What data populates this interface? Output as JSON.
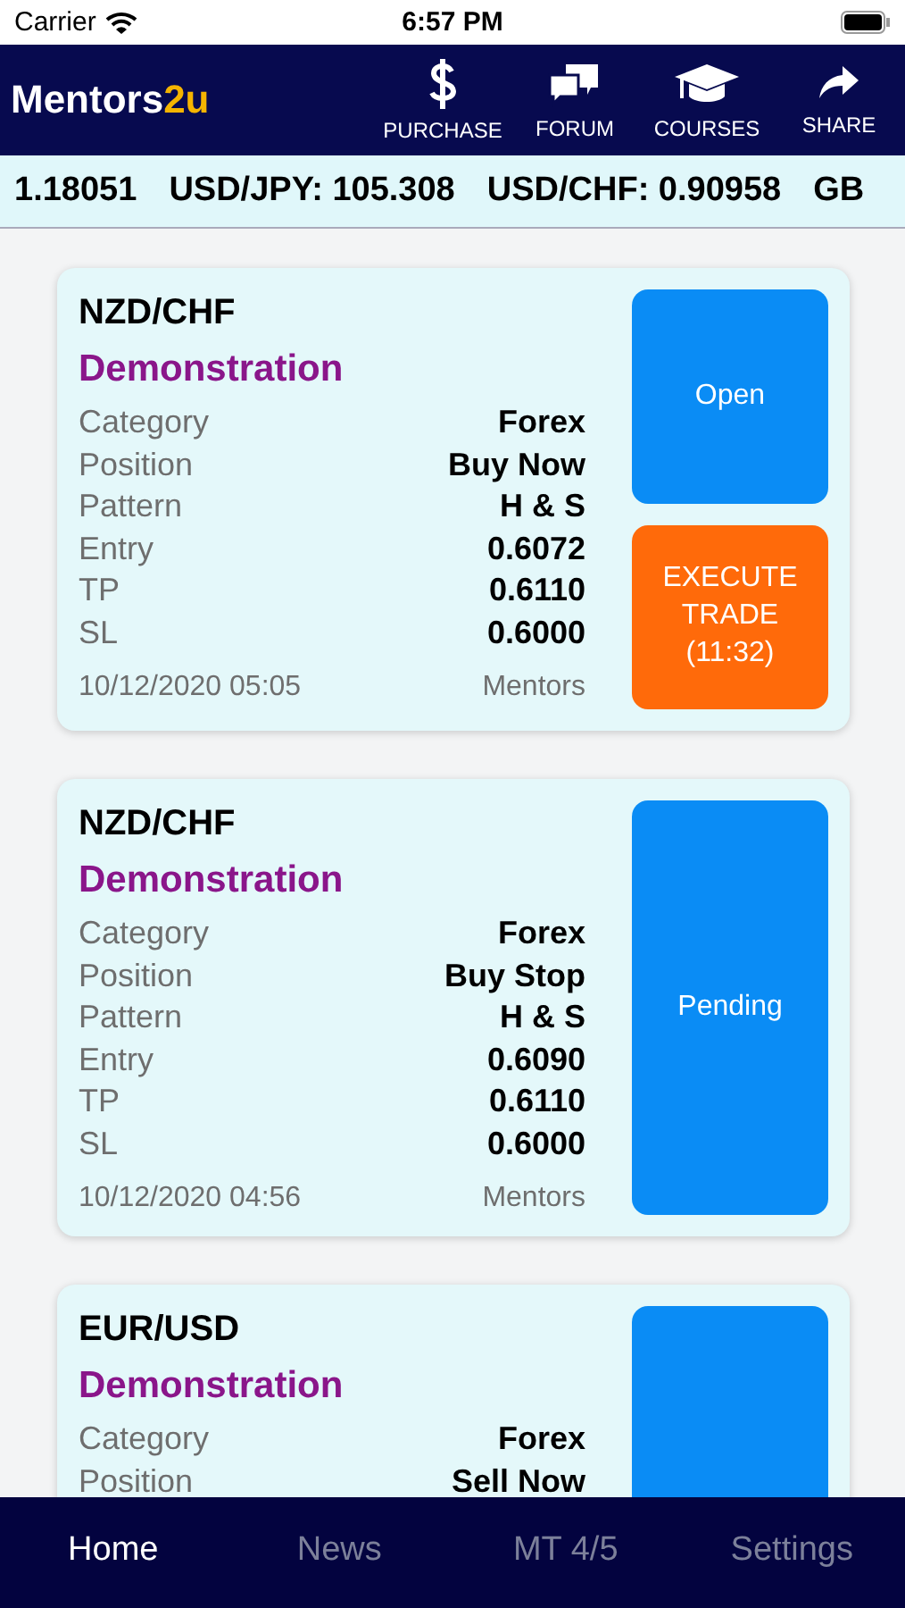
{
  "status_bar": {
    "carrier": "Carrier",
    "time": "6:57 PM"
  },
  "header": {
    "logo_main": "Mentors",
    "logo_accent": "2u",
    "actions": [
      {
        "label": "PURCHASE",
        "kind": "dollar"
      },
      {
        "label": "FORUM",
        "kind": "chat"
      },
      {
        "label": "COURSES",
        "kind": "cap"
      },
      {
        "label": "SHARE",
        "kind": "share"
      }
    ]
  },
  "ticker": [
    "1.18051",
    "USD/JPY: 105.308",
    "USD/CHF: 0.90958",
    "GB"
  ],
  "signals": [
    {
      "pair": "NZD/CHF",
      "type": "Demonstration",
      "rows": [
        {
          "label": "Category",
          "value": "Forex"
        },
        {
          "label": "Position",
          "value": "Buy Now"
        },
        {
          "label": "Pattern",
          "value": "H & S"
        },
        {
          "label": "Entry",
          "value": "0.6072"
        },
        {
          "label": "TP",
          "value": "0.6110"
        },
        {
          "label": "SL",
          "value": "0.6000"
        }
      ],
      "date": "10/12/2020 05:05",
      "author": "Mentors",
      "buttons": [
        {
          "kind": "status",
          "label": "Open"
        },
        {
          "kind": "execute",
          "label": "EXECUTE TRADE (11:32)"
        }
      ]
    },
    {
      "pair": "NZD/CHF",
      "type": "Demonstration",
      "rows": [
        {
          "label": "Category",
          "value": "Forex"
        },
        {
          "label": "Position",
          "value": "Buy Stop"
        },
        {
          "label": "Pattern",
          "value": "H & S"
        },
        {
          "label": "Entry",
          "value": "0.6090"
        },
        {
          "label": "TP",
          "value": "0.6110"
        },
        {
          "label": "SL",
          "value": "0.6000"
        }
      ],
      "date": "10/12/2020 04:56",
      "author": "Mentors",
      "buttons": [
        {
          "kind": "status",
          "label": "Pending"
        }
      ]
    },
    {
      "pair": "EUR/USD",
      "type": "Demonstration",
      "rows": [
        {
          "label": "Category",
          "value": "Forex"
        },
        {
          "label": "Position",
          "value": "Sell Now"
        }
      ],
      "buttons": [
        {
          "kind": "status"
        }
      ]
    }
  ],
  "tabs": [
    {
      "label": "Home",
      "selected": true
    },
    {
      "label": "News",
      "selected": false
    },
    {
      "label": "MT 4/5",
      "selected": false
    },
    {
      "label": "Settings",
      "selected": false
    }
  ]
}
